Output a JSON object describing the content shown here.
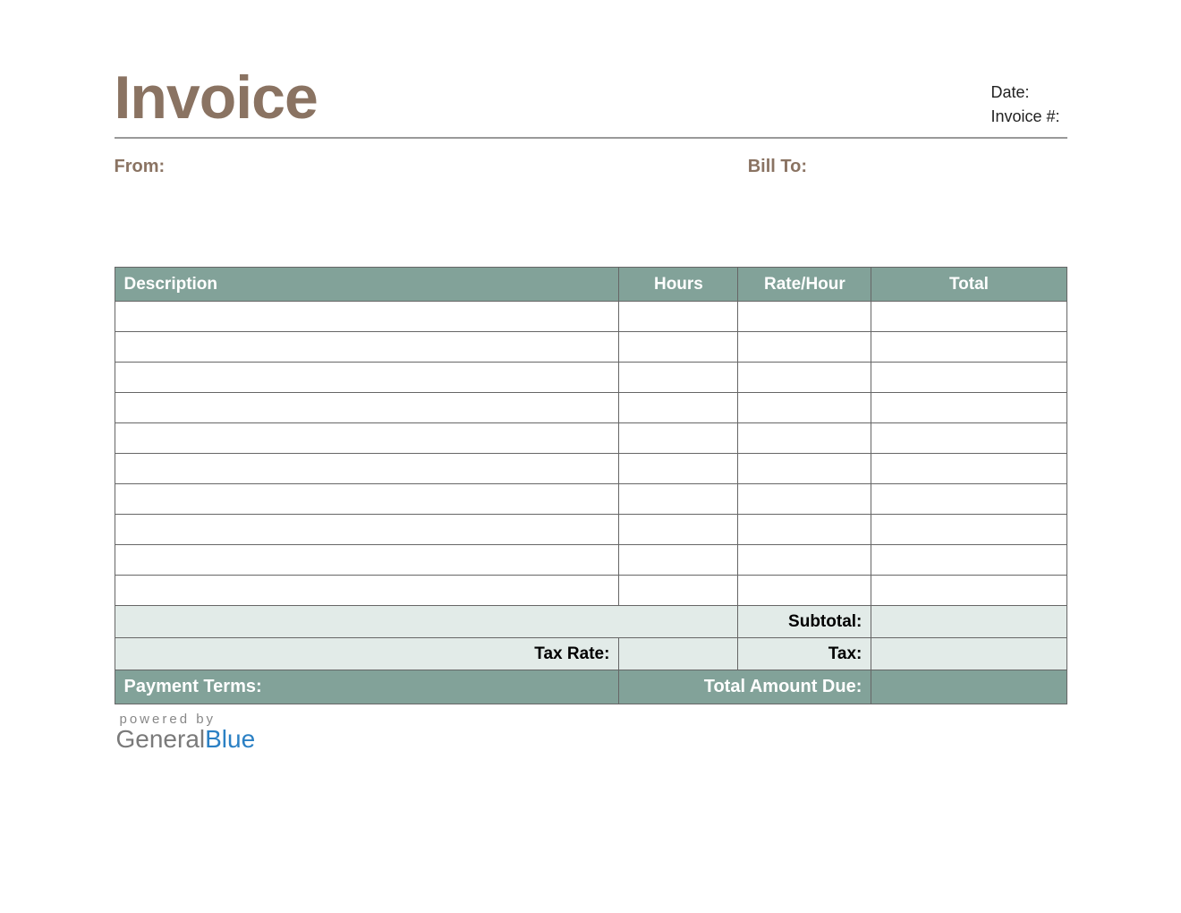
{
  "header": {
    "title": "Invoice",
    "date_label": "Date:",
    "date_value": "",
    "invoice_num_label": "Invoice #:",
    "invoice_num_value": ""
  },
  "parties": {
    "from_label": "From:",
    "from_value": "",
    "bill_to_label": "Bill To:",
    "bill_to_value": ""
  },
  "table": {
    "headers": {
      "description": "Description",
      "hours": "Hours",
      "rate": "Rate/Hour",
      "total": "Total"
    },
    "rows": [
      {
        "description": "",
        "hours": "",
        "rate": "",
        "total": ""
      },
      {
        "description": "",
        "hours": "",
        "rate": "",
        "total": ""
      },
      {
        "description": "",
        "hours": "",
        "rate": "",
        "total": ""
      },
      {
        "description": "",
        "hours": "",
        "rate": "",
        "total": ""
      },
      {
        "description": "",
        "hours": "",
        "rate": "",
        "total": ""
      },
      {
        "description": "",
        "hours": "",
        "rate": "",
        "total": ""
      },
      {
        "description": "",
        "hours": "",
        "rate": "",
        "total": ""
      },
      {
        "description": "",
        "hours": "",
        "rate": "",
        "total": ""
      },
      {
        "description": "",
        "hours": "",
        "rate": "",
        "total": ""
      },
      {
        "description": "",
        "hours": "",
        "rate": "",
        "total": ""
      }
    ],
    "summary": {
      "subtotal_label": "Subtotal:",
      "subtotal_value": "",
      "tax_rate_label": "Tax Rate:",
      "tax_rate_value": "",
      "tax_label": "Tax:",
      "tax_value": "",
      "payment_terms_label": "Payment Terms:",
      "payment_terms_value": "",
      "total_due_label": "Total Amount Due:",
      "total_due_value": ""
    }
  },
  "footer": {
    "powered_by": "powered by",
    "brand_part1": "General",
    "brand_part2": "Blue"
  },
  "colors": {
    "accent_brown": "#8a7362",
    "accent_teal": "#82a299",
    "accent_teal_light": "#e2ebe8",
    "brand_blue": "#2b80c4"
  }
}
